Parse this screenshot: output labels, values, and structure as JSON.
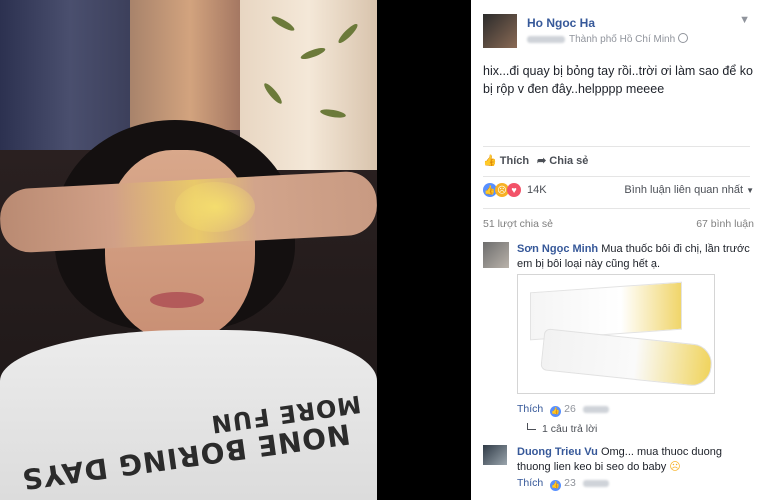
{
  "post": {
    "author": "Ho Ngoc Ha",
    "location": "Thành phố Hồ Chí Minh",
    "text": "hix...đi quay bị bỏng tay rồi..trời ơi làm sao để ko bị rộp v đen đây..helpppp meeee",
    "like_label": "Thích",
    "share_label": "Chia sẻ",
    "reaction_count": "14K",
    "sort_label": "Bình luận liên quan nhất",
    "shares_text": "51 lượt chia sẻ",
    "comments_text": "67 bình luận"
  },
  "comments": [
    {
      "name": "Sơn Ngọc Minh",
      "text": "Mua thuốc bôi đi chị, lần trước em bị bôi loại này cũng hết ạ.",
      "like_label": "Thích",
      "like_count": "26",
      "replies_label": "1 câu trả lời"
    },
    {
      "name": "Duong Trieu Vu",
      "text": "Omg... mua thuoc duong thuong lien keo bi seo do baby",
      "like_label": "Thích",
      "like_count": "23"
    }
  ],
  "photo": {
    "shirt_line1": "NONE BORING DAYS",
    "shirt_line2": "MORE FUN"
  },
  "colors": {
    "link_blue": "#365899",
    "like_blue": "#5890ff",
    "love_red": "#f25268",
    "haha_yellow": "#f7b125"
  },
  "icons": [
    "like-icon",
    "share-icon",
    "like-reaction-icon",
    "sad-reaction-icon",
    "love-reaction-icon",
    "chevron-down-icon",
    "globe-icon"
  ]
}
